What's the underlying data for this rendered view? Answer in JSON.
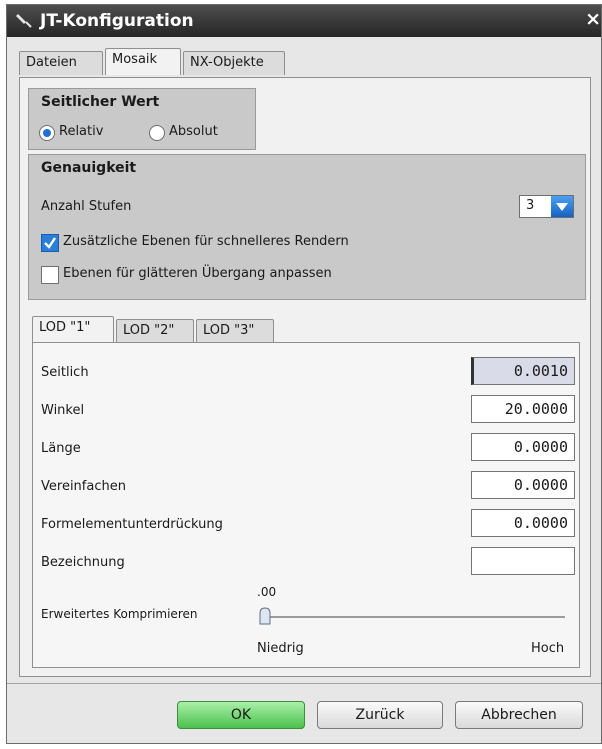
{
  "window": {
    "title": "JT-Konfiguration",
    "close_glyph": "×"
  },
  "tabs": [
    {
      "label": "Dateien",
      "active": false
    },
    {
      "label": "Mosaik",
      "active": true
    },
    {
      "label": "NX-Objekte",
      "active": false
    }
  ],
  "seitlicher_wert": {
    "title": "Seitlicher Wert",
    "options": [
      {
        "label": "Relativ",
        "selected": true
      },
      {
        "label": "Absolut",
        "selected": false
      }
    ]
  },
  "genauigkeit": {
    "title": "Genauigkeit",
    "anzahl_stufen_label": "Anzahl Stufen",
    "anzahl_stufen_value": "3",
    "checks": [
      {
        "label": "Zusätzliche Ebenen für schnelleres Rendern",
        "checked": true
      },
      {
        "label": "Ebenen für glätteren Übergang anpassen",
        "checked": false
      }
    ]
  },
  "lod_tabs": [
    {
      "label": "LOD \"1\"",
      "active": true
    },
    {
      "label": "LOD \"2\"",
      "active": false
    },
    {
      "label": "LOD \"3\"",
      "active": false
    }
  ],
  "fields": [
    {
      "label": "Seitlich",
      "value": "0.0010"
    },
    {
      "label": "Winkel",
      "value": "20.0000"
    },
    {
      "label": "Länge",
      "value": "0.0000"
    },
    {
      "label": "Vereinfachen",
      "value": "0.0000"
    },
    {
      "label": "Formelementunterdrückung",
      "value": "0.0000"
    },
    {
      "label": "Bezeichnung",
      "value": ""
    }
  ],
  "slider": {
    "label": "Erweitertes Komprimieren",
    "value_text": ".00",
    "value_fraction": 0.0,
    "min_label": "Niedrig",
    "max_label": "Hoch"
  },
  "buttons": {
    "ok": "OK",
    "back": "Zurück",
    "cancel": "Abbrechen"
  },
  "colors": {
    "accent": "#1f6fd6",
    "ok_button": "#4cc14c",
    "titlebar": "#262626"
  }
}
